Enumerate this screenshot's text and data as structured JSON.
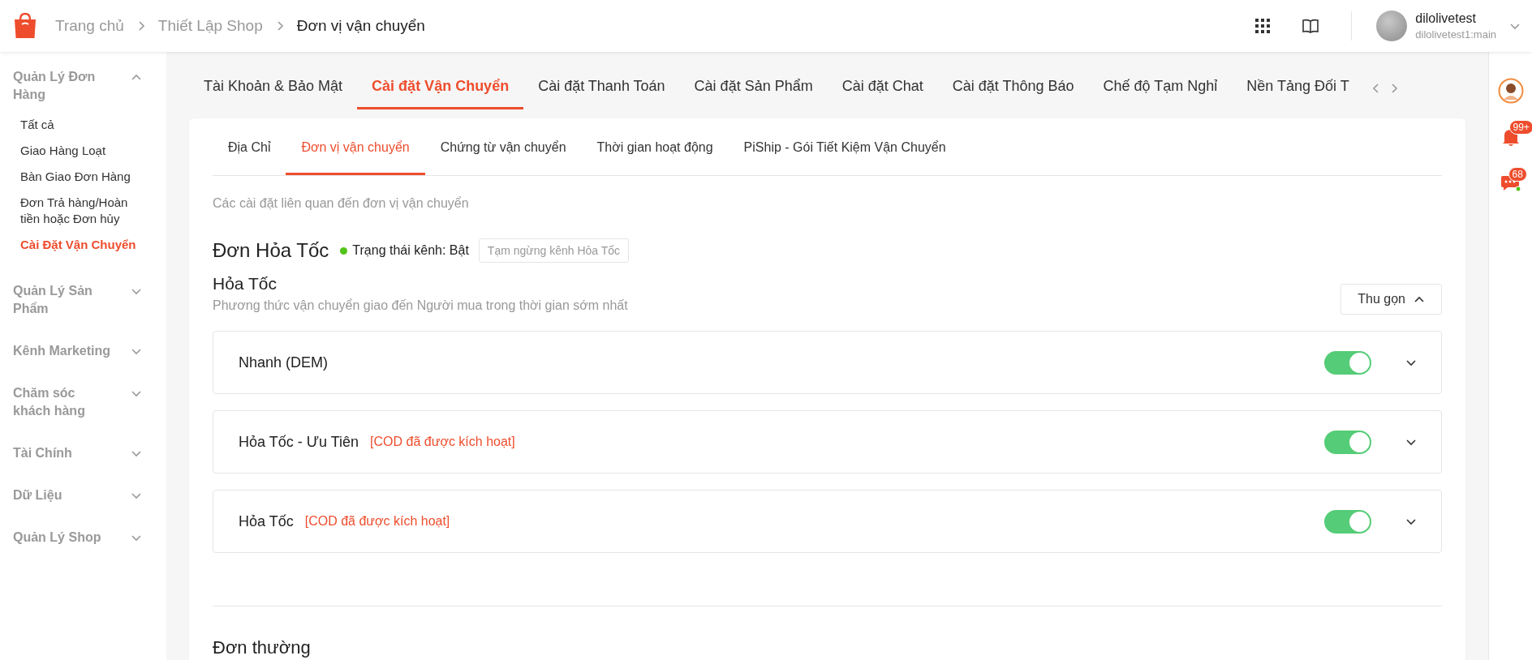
{
  "breadcrumb": [
    "Trang chủ",
    "Thiết Lập Shop",
    "Đơn vị vận chuyển"
  ],
  "user": {
    "name": "dilolivetest",
    "account": "dilolivetest1:main"
  },
  "sidebar": [
    {
      "label": "Quản Lý Đơn Hàng",
      "expanded": true,
      "children": [
        {
          "label": "Tất cả",
          "selected": false
        },
        {
          "label": "Giao Hàng Loạt",
          "selected": false
        },
        {
          "label": "Bàn Giao Đơn Hàng",
          "selected": false
        },
        {
          "label": "Đơn Trả hàng/Hoàn tiền hoặc Đơn hủy",
          "selected": false
        },
        {
          "label": "Cài Đặt Vận Chuyển",
          "selected": true
        }
      ]
    },
    {
      "label": "Quản Lý Sản Phẩm",
      "expanded": false
    },
    {
      "label": "Kênh Marketing",
      "expanded": false
    },
    {
      "label": "Chăm sóc khách hàng",
      "expanded": false
    },
    {
      "label": "Tài Chính",
      "expanded": false
    },
    {
      "label": "Dữ Liệu",
      "expanded": false
    },
    {
      "label": "Quản Lý Shop",
      "expanded": false
    }
  ],
  "main_tabs": [
    {
      "label": "Tài Khoản & Bảo Mật",
      "selected": false
    },
    {
      "label": "Cài đặt Vận Chuyển",
      "selected": true
    },
    {
      "label": "Cài đặt Thanh Toán",
      "selected": false
    },
    {
      "label": "Cài đặt Sản Phẩm",
      "selected": false
    },
    {
      "label": "Cài đặt Chat",
      "selected": false
    },
    {
      "label": "Cài đặt Thông Báo",
      "selected": false
    },
    {
      "label": "Chế độ Tạm Nghỉ",
      "selected": false
    },
    {
      "label": "Nền Tảng Đối T",
      "selected": false
    }
  ],
  "sub_tabs": [
    {
      "label": "Địa Chỉ",
      "selected": false
    },
    {
      "label": "Đơn vị vận chuyển",
      "selected": true
    },
    {
      "label": "Chứng từ vận chuyển",
      "selected": false
    },
    {
      "label": "Thời gian hoạt động",
      "selected": false
    },
    {
      "label": "PiShip - Gói Tiết Kiệm Vận Chuyển",
      "selected": false
    }
  ],
  "description": "Các cài đặt liên quan đến đơn vị vận chuyển",
  "express_section": {
    "title": "Đơn Hỏa Tốc",
    "status": {
      "label": "Trạng thái kênh: Bật",
      "on": true
    },
    "action": "Tạm ngừng kênh Hỏa Tốc"
  },
  "group": {
    "title": "Hỏa Tốc",
    "description": "Phương thức vận chuyển giao đến Người mua trong thời gian sớm nhất",
    "collapse_button": "Thu gọn",
    "expanded": true
  },
  "services": [
    {
      "name": "Nhanh (DEM)",
      "on": true
    },
    {
      "name": "Hỏa Tốc - Ưu Tiên",
      "note": "[COD đã được kích hoạt]",
      "on": true
    },
    {
      "name": "Hỏa Tốc",
      "note": "[COD đã được kích hoạt]",
      "on": true
    }
  ],
  "next_section": {
    "title": "Đơn thường"
  },
  "right_rail": {
    "notification_badge": "99+",
    "chat_badge": "68"
  }
}
